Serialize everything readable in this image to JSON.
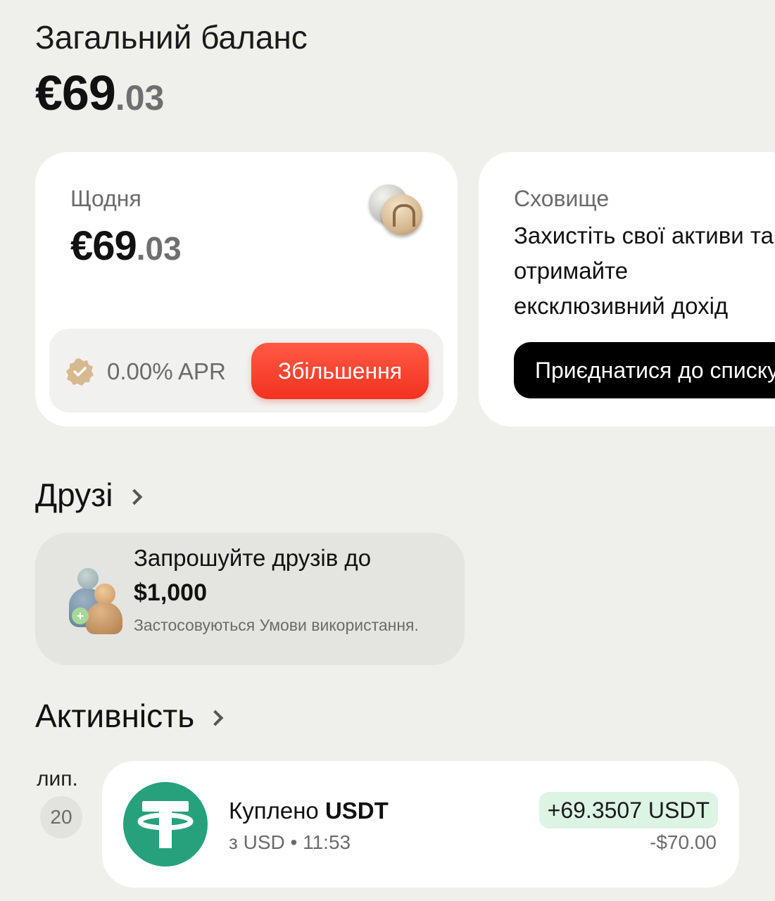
{
  "header": {
    "total_label": "Загальний баланс",
    "total_whole": "€69",
    "total_decimal": ".03"
  },
  "daily_card": {
    "label": "Щодня",
    "amount_whole": "€69",
    "amount_decimal": ".03",
    "icon": "coins-icon",
    "apr_text": "0.00% APR",
    "apr_icon": "verified-badge-icon",
    "increase_label": "Збільшення"
  },
  "vault_card": {
    "label": "Сховище",
    "text": "Захистіть свої активи та отримайте ексклюзивний дохід",
    "join_label": "Приєднатися до списку"
  },
  "friends": {
    "title": "Друзі",
    "line1": "Запрошуйте друзів до",
    "amount": "$1,000",
    "terms": "Застосовуються Умови використання."
  },
  "activity": {
    "title": "Активність",
    "date_month": "лип.",
    "date_day": "20",
    "transaction": {
      "title_prefix": "Куплено ",
      "asset": "USDT",
      "subtitle": "з USD • 11:53",
      "amount": "+69.3507 USDT",
      "fiat": "-$70.00",
      "icon": "tether-icon"
    }
  },
  "colors": {
    "background": "#efefeb",
    "accent_red": "#f2321f",
    "tether_green": "#26a17b",
    "positive_bg": "#dcf4e4"
  }
}
